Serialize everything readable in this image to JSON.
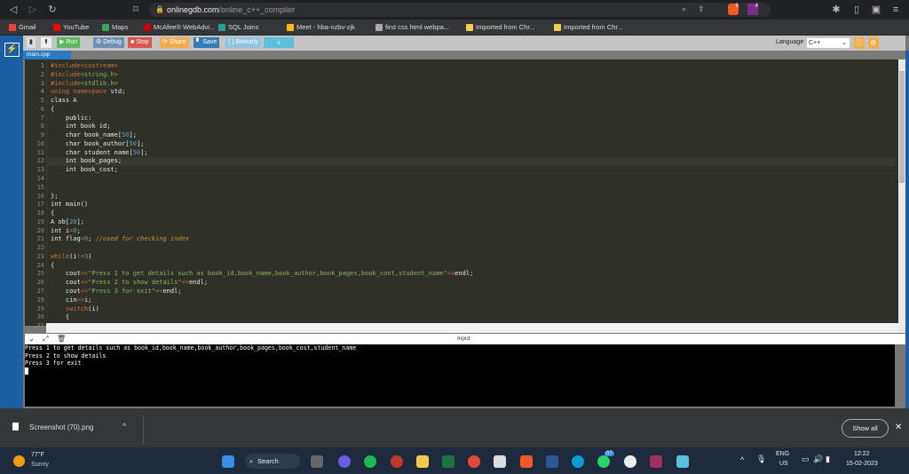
{
  "browser": {
    "url_host": "onlinegdb.com",
    "url_path": "/online_c++_compiler",
    "ext_badge_1": "6",
    "ext_badge_2": "4"
  },
  "bookmarks": [
    {
      "label": "Gmail",
      "color": "#ea4335"
    },
    {
      "label": "YouTube",
      "color": "#ff0000"
    },
    {
      "label": "Maps",
      "color": "#34a853"
    },
    {
      "label": "McAfee® WebAdvi...",
      "color": "#c00"
    },
    {
      "label": "SQL Joins",
      "color": "#2a9d8f"
    },
    {
      "label": "Meet - hba-nzbv-zjk",
      "color": "#fbbc04"
    },
    {
      "label": "first css html webpa...",
      "color": "#aaa"
    },
    {
      "label": "Imported from Chr...",
      "color": "#f2c94c"
    },
    {
      "label": "Imported from Chr...",
      "color": "#f2c94c"
    }
  ],
  "toolbar": {
    "run": "Run",
    "debug": "Debug",
    "stop": "Stop",
    "share": "Share",
    "save": "Save",
    "beautify": "{ } Beautify",
    "download": "⤓",
    "language_label": "Language",
    "language_value": "C++"
  },
  "file_tab": "main.cpp",
  "editor": {
    "lines": [
      [
        [
          "#include<iostream>",
          "k"
        ]
      ],
      [
        [
          "#include",
          "k"
        ],
        [
          "<string.h>",
          "s"
        ]
      ],
      [
        [
          "#include",
          "k"
        ],
        [
          "<stdlib.h>",
          "s"
        ]
      ],
      [
        [
          "using namespace ",
          "k"
        ],
        [
          "std;",
          "p"
        ]
      ],
      [
        [
          "class A",
          "p"
        ]
      ],
      [
        [
          "{",
          "p"
        ]
      ],
      [
        [
          "    public:",
          "p"
        ]
      ],
      [
        [
          "    int book id;",
          "p"
        ]
      ],
      [
        [
          "    char book_name[",
          "p"
        ],
        [
          "50",
          "n"
        ],
        [
          "];",
          "p"
        ]
      ],
      [
        [
          "    char book_author[",
          "p"
        ],
        [
          "50",
          "n"
        ],
        [
          "];",
          "p"
        ]
      ],
      [
        [
          "    char student name[",
          "p"
        ],
        [
          "50",
          "n"
        ],
        [
          "];",
          "p"
        ]
      ],
      [
        [
          "    int book_pages;",
          "p"
        ]
      ],
      [
        [
          "    int book_cost;",
          "p"
        ]
      ],
      [
        [
          "",
          "p"
        ]
      ],
      [
        [
          "",
          "p"
        ]
      ],
      [
        [
          "};",
          "p"
        ]
      ],
      [
        [
          "int main()",
          "p"
        ]
      ],
      [
        [
          "{",
          "p"
        ]
      ],
      [
        [
          "A ob[",
          "p"
        ],
        [
          "20",
          "n"
        ],
        [
          "];",
          "p"
        ]
      ],
      [
        [
          "int i",
          "p"
        ],
        [
          "=",
          "k"
        ],
        [
          "0",
          "n"
        ],
        [
          ";",
          "p"
        ]
      ],
      [
        [
          "int flag",
          "p"
        ],
        [
          "=",
          "k"
        ],
        [
          "0",
          "n"
        ],
        [
          "; ",
          "p"
        ],
        [
          "//used for checking index",
          "c"
        ]
      ],
      [
        [
          "",
          "p"
        ]
      ],
      [
        [
          "while",
          "k"
        ],
        [
          "(i",
          "p"
        ],
        [
          "!=",
          "k"
        ],
        [
          "3",
          "n"
        ],
        [
          ")",
          "p"
        ]
      ],
      [
        [
          "{",
          "p"
        ]
      ],
      [
        [
          "    cout",
          "p"
        ],
        [
          "<<",
          "k"
        ],
        [
          "\"Press 1 to get details such as book_id,book_name,book_author,book_pages,book_cost,student_name\"",
          "s"
        ],
        [
          "<<",
          "k"
        ],
        [
          "endl;",
          "p"
        ]
      ],
      [
        [
          "    cout",
          "p"
        ],
        [
          "<<",
          "k"
        ],
        [
          "\"Press 2 to show details\"",
          "s"
        ],
        [
          "<<",
          "k"
        ],
        [
          "endl;",
          "p"
        ]
      ],
      [
        [
          "    cout",
          "p"
        ],
        [
          "<<",
          "k"
        ],
        [
          "\"Press 3 for exit\"",
          "s"
        ],
        [
          "<<",
          "k"
        ],
        [
          "endl;",
          "p"
        ]
      ],
      [
        [
          "    cin",
          "p"
        ],
        [
          ">>",
          "k"
        ],
        [
          "i;",
          "p"
        ]
      ],
      [
        [
          "    switch",
          "k"
        ],
        [
          "(i)",
          "p"
        ]
      ],
      [
        [
          "    {",
          "p"
        ]
      ],
      [
        [
          "",
          "p"
        ]
      ]
    ]
  },
  "input_label": "Input",
  "console": [
    "Press 1 to get details such as book_id,book_name,book_author,book_pages,book_cost,student_name",
    "Press 2 to show details",
    "Press 3 for exit"
  ],
  "downloads": {
    "file": "Screenshot (70).png",
    "show_all": "Show all"
  },
  "taskbar": {
    "temp": "77°F",
    "weather": "Sunny",
    "search": "Search",
    "lang1": "ENG",
    "lang2": "US",
    "time": "12:22",
    "date": "15-02-2023",
    "whatsapp_badge": "07"
  }
}
